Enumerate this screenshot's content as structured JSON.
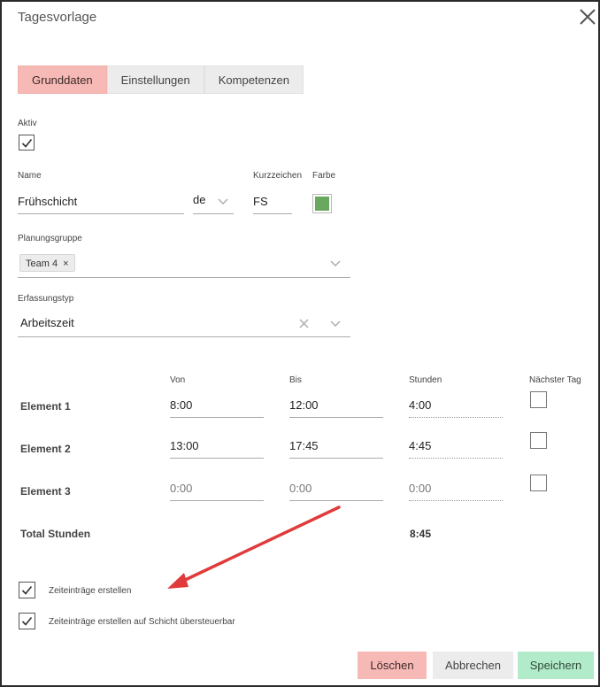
{
  "dialog": {
    "title": "Tagesvorlage",
    "close_icon": "close-icon"
  },
  "tabs": [
    {
      "label": "Grunddaten",
      "active": true
    },
    {
      "label": "Einstellungen",
      "active": false
    },
    {
      "label": "Kompetenzen",
      "active": false
    }
  ],
  "aktiv": {
    "label": "Aktiv",
    "checked": true
  },
  "name": {
    "label": "Name",
    "value": "Frühschicht",
    "language": "de"
  },
  "kurzzeichen": {
    "label": "Kurzzeichen",
    "value": "FS"
  },
  "farbe": {
    "label": "Farbe",
    "color": "#6aa85f"
  },
  "planungsgruppe": {
    "label": "Planungsgruppe",
    "chips": [
      "Team 4"
    ]
  },
  "erfassungstyp": {
    "label": "Erfassungstyp",
    "value": "Arbeitszeit"
  },
  "elements": {
    "headers": {
      "von": "Von",
      "bis": "Bis",
      "stunden": "Stunden",
      "naechster_tag": "Nächster Tag"
    },
    "rows": [
      {
        "name": "Element 1",
        "von": "8:00",
        "bis": "12:00",
        "stunden": "4:00",
        "naechster_tag": false
      },
      {
        "name": "Element 2",
        "von": "13:00",
        "bis": "17:45",
        "stunden": "4:45",
        "naechster_tag": false
      },
      {
        "name": "Element 3",
        "von": "0:00",
        "bis": "0:00",
        "stunden": "0:00",
        "naechster_tag": false
      }
    ],
    "total_label": "Total Stunden",
    "total_value": "8:45"
  },
  "options": [
    {
      "label": "Zeiteinträge erstellen",
      "checked": true
    },
    {
      "label": "Zeiteinträge erstellen auf Schicht übersteuerbar",
      "checked": true
    }
  ],
  "buttons": {
    "delete": "Löschen",
    "cancel": "Abbrechen",
    "save": "Speichern"
  },
  "colors": {
    "accent_tab": "#f7b9b5",
    "delete_bg": "#f7b9b5",
    "cancel_bg": "#ececec",
    "save_bg": "#b2ebc9",
    "arrow": "#e03a3a"
  }
}
